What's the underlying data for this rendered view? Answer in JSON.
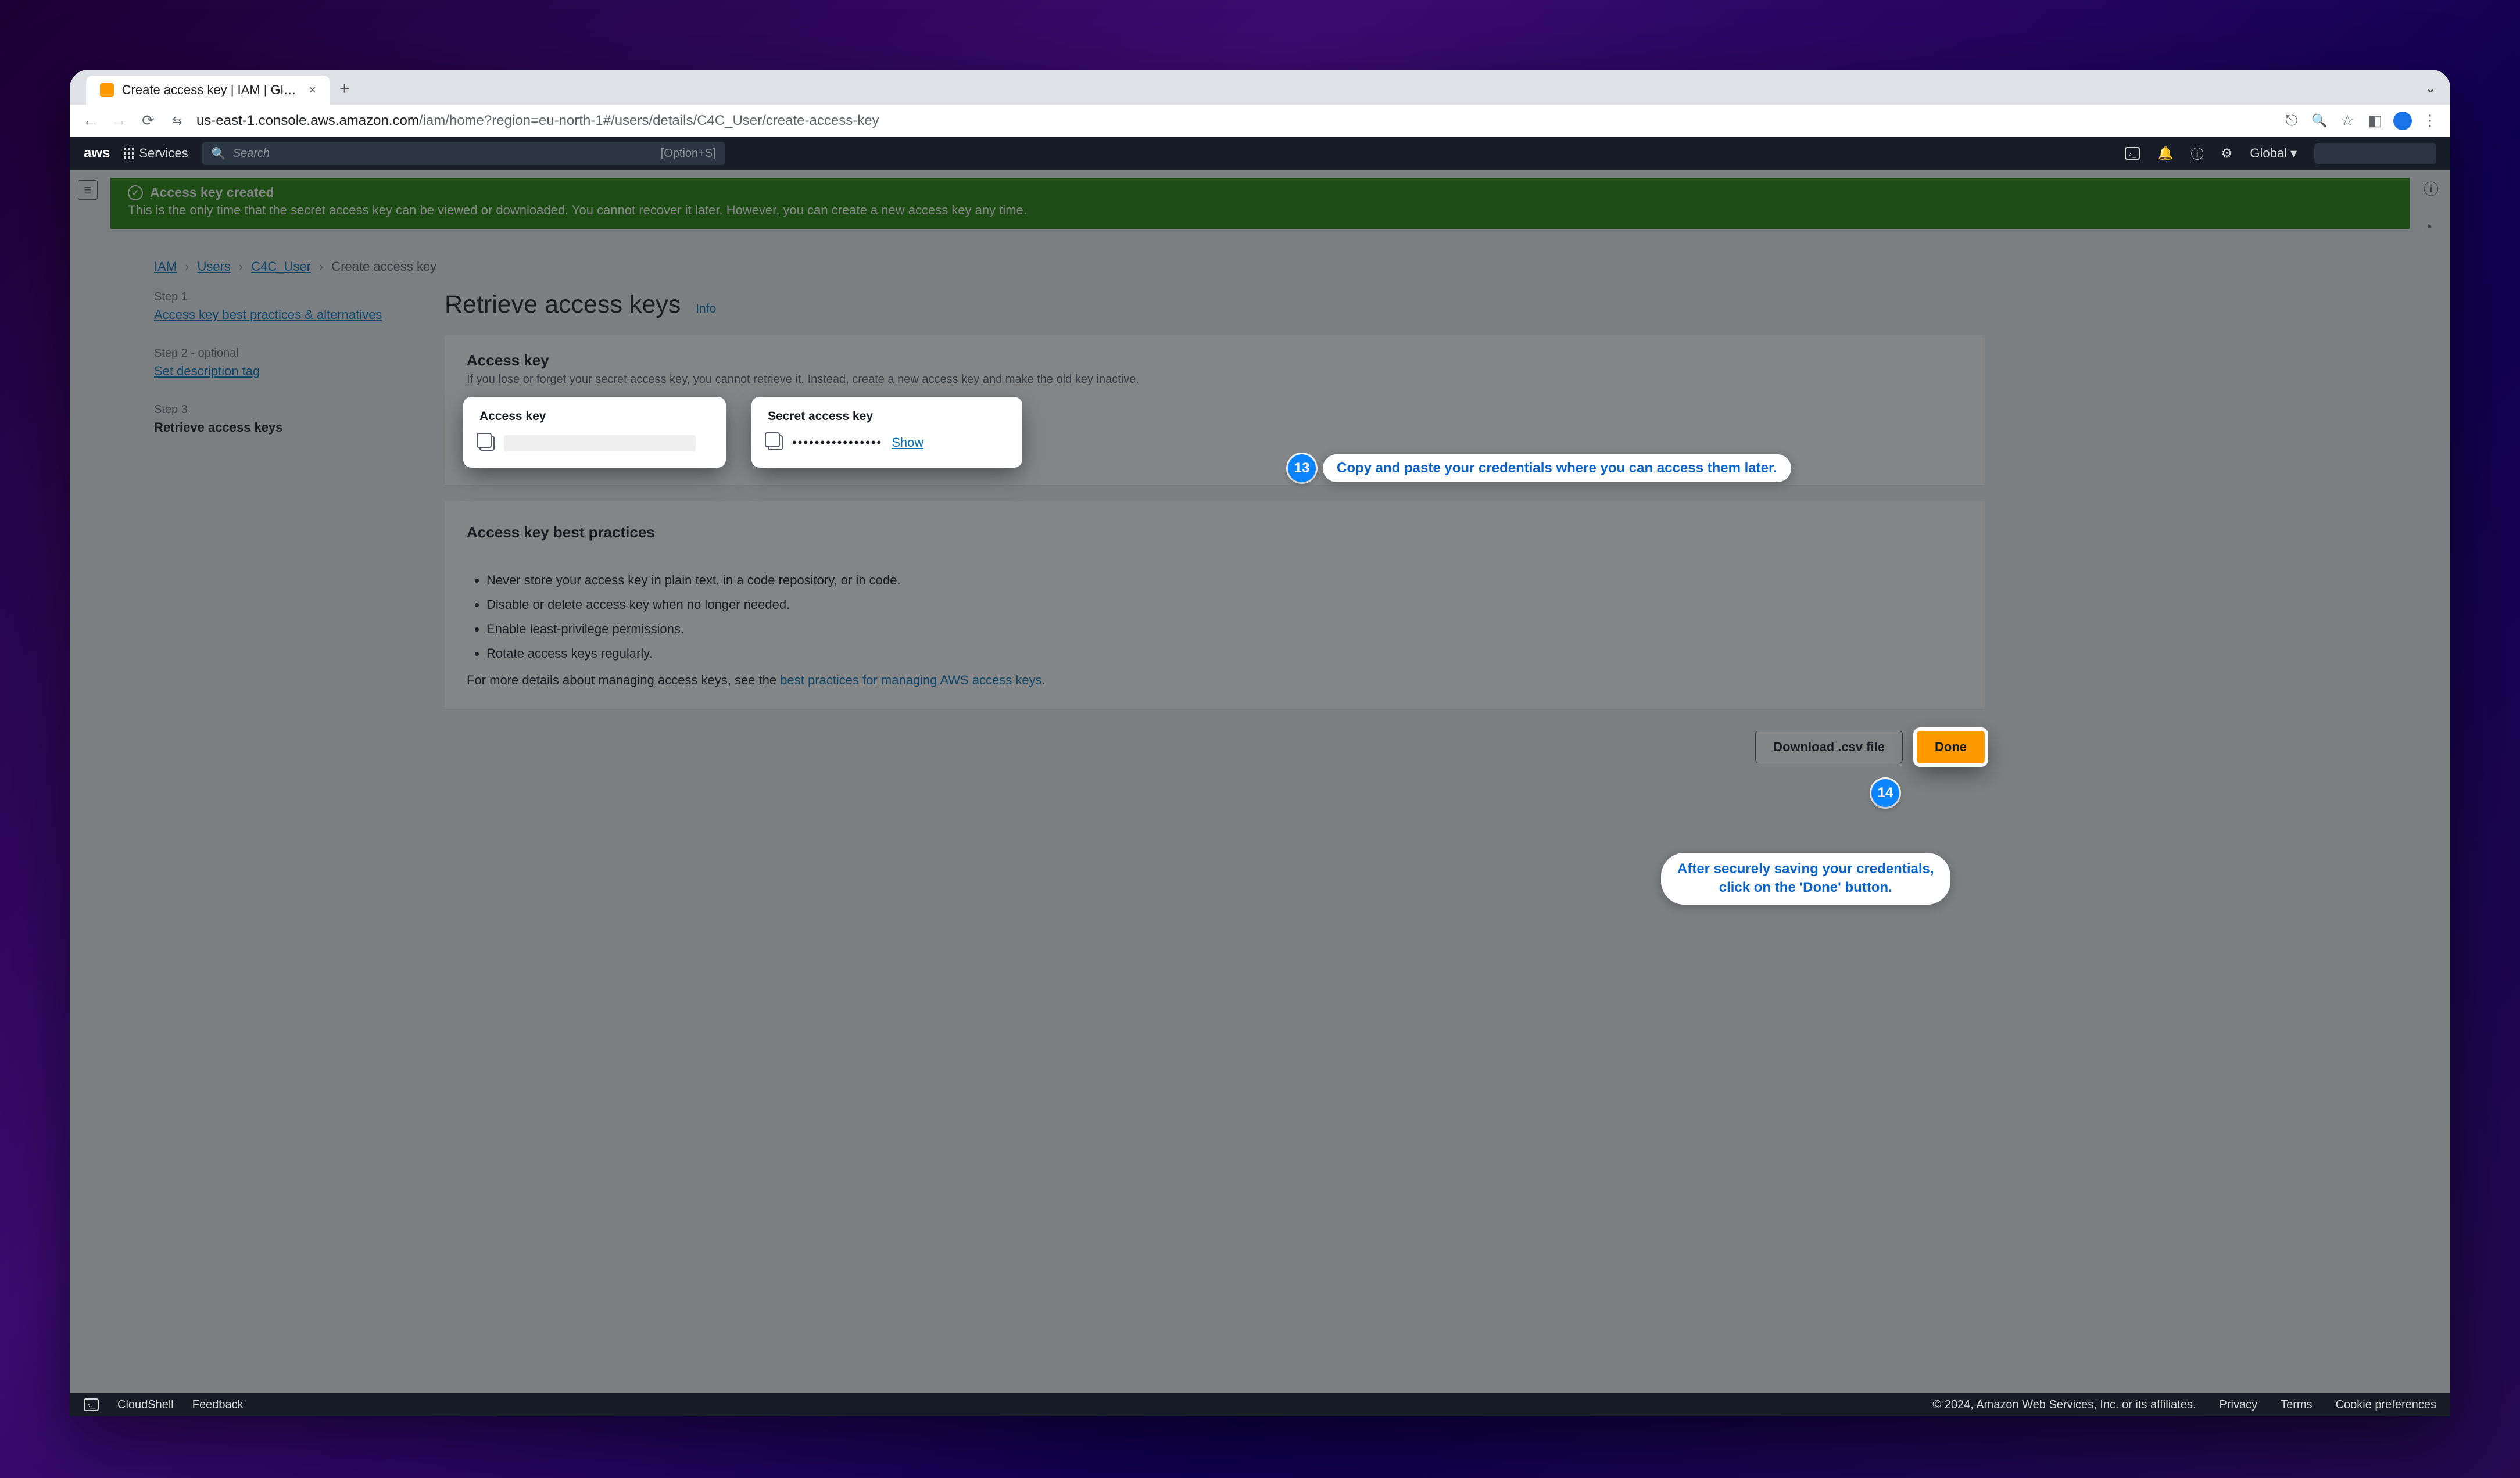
{
  "browser": {
    "tab_title": "Create access key | IAM | Glo…",
    "url_host": "us-east-1.console.aws.amazon.com",
    "url_path": "/iam/home?region=eu-north-1#/users/details/C4C_User/create-access-key"
  },
  "aws_top": {
    "services": "Services",
    "search_placeholder": "Search",
    "search_hint": "[Option+S]",
    "region": "Global"
  },
  "notice": {
    "title": "Access key created",
    "body": "This is the only time that the secret access key can be viewed or downloaded. You cannot recover it later. However, you can create a new access key any time."
  },
  "breadcrumb": {
    "iam": "IAM",
    "users": "Users",
    "user": "C4C_User",
    "current": "Create access key"
  },
  "wizard": {
    "step1_label": "Step 1",
    "step1_link": "Access key best practices & alternatives",
    "step2_label": "Step 2 - optional",
    "step2_link": "Set description tag",
    "step3_label": "Step 3",
    "step3_title": "Retrieve access keys"
  },
  "page_title": "Retrieve access keys",
  "page_title_info": "Info",
  "key_panel": {
    "title": "Access key",
    "desc": "If you lose or forget your secret access key, you cannot retrieve it. Instead, create a new access key and make the old key inactive.",
    "access_key_label": "Access key",
    "secret_key_label": "Secret access key",
    "secret_value_mask": "••••••••••••••••",
    "show": "Show"
  },
  "best_practices": {
    "title": "Access key best practices",
    "items": [
      "Never store your access key in plain text, in a code repository, or in code.",
      "Disable or delete access key when no longer needed.",
      "Enable least-privilege permissions.",
      "Rotate access keys regularly."
    ],
    "foot_prefix": "For more details about managing access keys, see the ",
    "foot_link": "best practices for managing AWS access keys"
  },
  "actions": {
    "download": "Download .csv file",
    "done": "Done"
  },
  "annotations": {
    "a13_num": "13",
    "a13_text": "Copy and paste your credentials where you can access them later.",
    "a14_num": "14",
    "a14_text_l1": "After securely saving your credentials,",
    "a14_text_l2": "click on the 'Done' button."
  },
  "footer": {
    "cloudshell": "CloudShell",
    "feedback": "Feedback",
    "copyright": "© 2024, Amazon Web Services, Inc. or its affiliates.",
    "privacy": "Privacy",
    "terms": "Terms",
    "cookies": "Cookie preferences"
  }
}
